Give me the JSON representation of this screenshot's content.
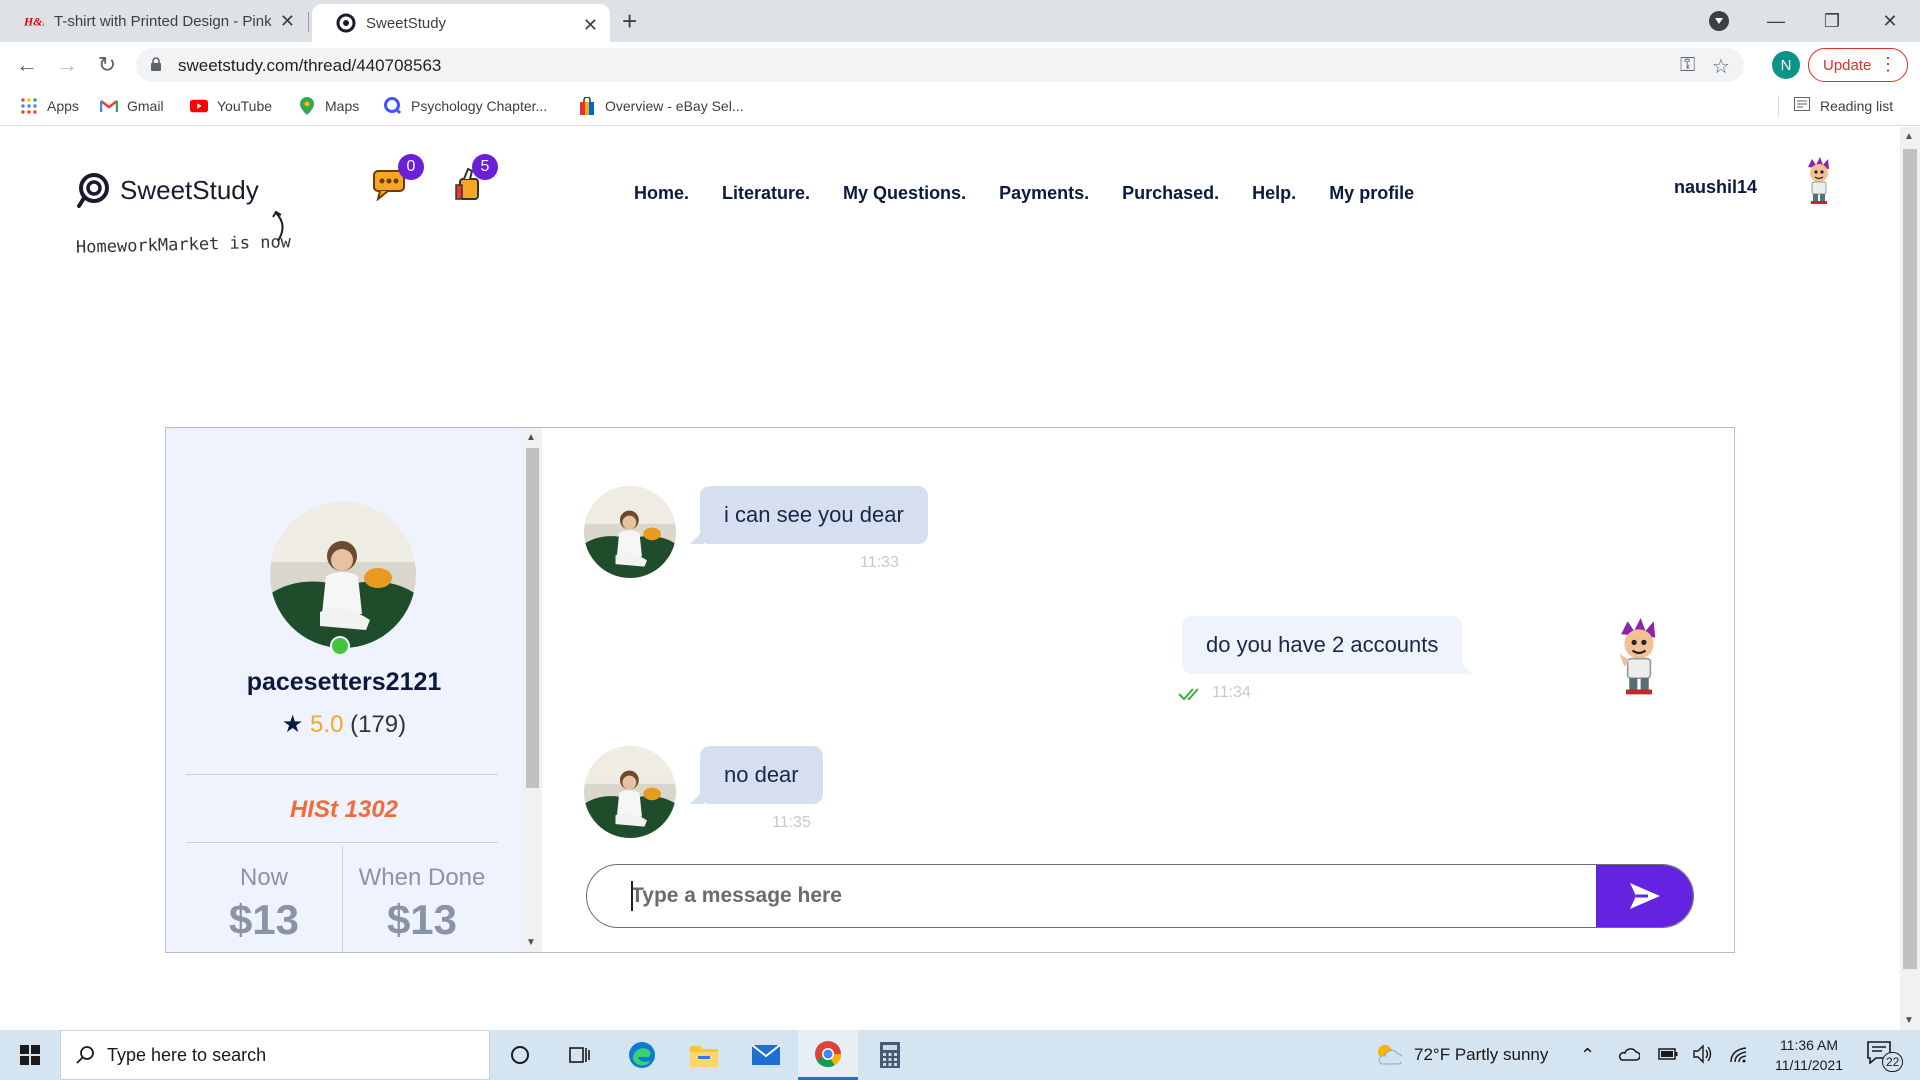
{
  "browser": {
    "tabs": [
      {
        "title": "T-shirt with Printed Design - Pink",
        "favicon": "hm-logo-icon",
        "active": false
      },
      {
        "title": "SweetStudy",
        "favicon": "sweetstudy-icon",
        "active": true
      }
    ],
    "url": "sweetstudy.com/thread/440708563",
    "account_initial": "N",
    "update_label": "Update",
    "bookmarks": [
      {
        "label": "Apps",
        "icon": "apps-grid-icon"
      },
      {
        "label": "Gmail",
        "icon": "gmail-icon"
      },
      {
        "label": "YouTube",
        "icon": "youtube-icon"
      },
      {
        "label": "Maps",
        "icon": "maps-pin-icon"
      },
      {
        "label": "Psychology Chapter...",
        "icon": "quizlet-icon"
      },
      {
        "label": "Overview - eBay Sel...",
        "icon": "shopping-bag-icon"
      }
    ],
    "reading_list": "Reading list"
  },
  "site": {
    "brand": "SweetStudy",
    "tagline": "HomeworkMarket is now",
    "messages_count": "0",
    "notifications_count": "5",
    "nav": [
      "Home.",
      "Literature.",
      "My Questions.",
      "Payments.",
      "Purchased.",
      "Help.",
      "My profile"
    ],
    "username": "naushil14"
  },
  "profile": {
    "username": "pacesetters2121",
    "rating_star": "★",
    "rating": "5.0",
    "reviews": "(179)",
    "course": "HISt 1302",
    "now_label": "Now",
    "now_amount": "$13",
    "done_label": "When Done",
    "done_amount": "$13",
    "online": true
  },
  "chat": {
    "messages": [
      {
        "direction": "in",
        "text": "i can see you dear",
        "time": "11:33"
      },
      {
        "direction": "out",
        "text": "do you have 2 accounts",
        "time": "11:34",
        "read": true
      },
      {
        "direction": "in",
        "text": "no dear",
        "time": "11:35"
      }
    ],
    "composer_placeholder": "Type a message here"
  },
  "taskbar": {
    "search_placeholder": "Type here to search",
    "weather": "72°F  Partly sunny",
    "time": "11:36 AM",
    "date": "11/11/2021",
    "notification_count": "22"
  },
  "colors": {
    "accent": "#6323e0",
    "badge": "#6b1fd8",
    "course": "#f26b3a",
    "online": "#45c43b",
    "rating": "#f5a623"
  }
}
